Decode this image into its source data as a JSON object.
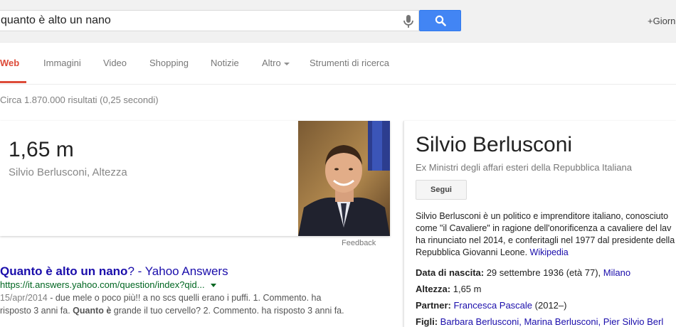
{
  "search": {
    "query": "quanto è alto un nano",
    "plus_link": "+Giorn"
  },
  "tabs": [
    {
      "label": "Web",
      "active": true
    },
    {
      "label": "Immagini"
    },
    {
      "label": "Video"
    },
    {
      "label": "Shopping"
    },
    {
      "label": "Notizie"
    },
    {
      "label": "Altro"
    },
    {
      "label": "Strumenti di ricerca"
    }
  ],
  "result_stats": "Circa 1.870.000 risultati (0,25 secondi)",
  "answer": {
    "value": "1,65 m",
    "subject": "Silvio Berlusconi, Altezza",
    "feedback": "Feedback"
  },
  "results": [
    {
      "title_bold": "Quanto è alto un nano",
      "title_rest": "? - Yahoo Answers",
      "url": "https://it.answers.yahoo.com/question/index?qid...",
      "date": "15/apr/2014",
      "snippet_1": " - due mele o poco più!! a no scs quelli erano i puffi. 1. Commento. ha",
      "snippet_2_a": "risposto 3 anni fa. ",
      "snippet_2_bold": "Quanto è",
      "snippet_2_b": " grande il tuo cervello? 2. Commento. ha risposto 3 anni fa."
    }
  ],
  "knowledge_panel": {
    "title": "Silvio Berlusconi",
    "subtitle": "Ex Ministri degli affari esteri della Repubblica Italiana",
    "follow_label": "Segui",
    "desc_lines": [
      "Silvio Berlusconi è un politico e imprenditore italiano, conosciuto",
      "come \"il Cavaliere\" in ragione dell'onorificenza a cavaliere del lav",
      "ha rinunciato nel 2014, e conferitagli nel 1977 dal presidente della",
      "Repubblica Giovanni Leone. "
    ],
    "desc_link": "Wikipedia",
    "facts": {
      "birth_label": "Data di nascita:",
      "birth_value": " 29 settembre 1936 (età 77), ",
      "birth_place": "Milano",
      "height_label": "Altezza:",
      "height_value": " 1,65 m",
      "partner_label": "Partner:",
      "partner_link": "Francesca Pascale",
      "partner_years": " (2012–)",
      "children_label": "Figli:",
      "children_value": "Barbara Berlusconi, Marina Berlusconi, Pier Silvio Berl"
    }
  },
  "colors": {
    "accent_red": "#dd4b39",
    "link_blue": "#1a0dab",
    "url_green": "#006621",
    "search_button": "#4285f4"
  }
}
